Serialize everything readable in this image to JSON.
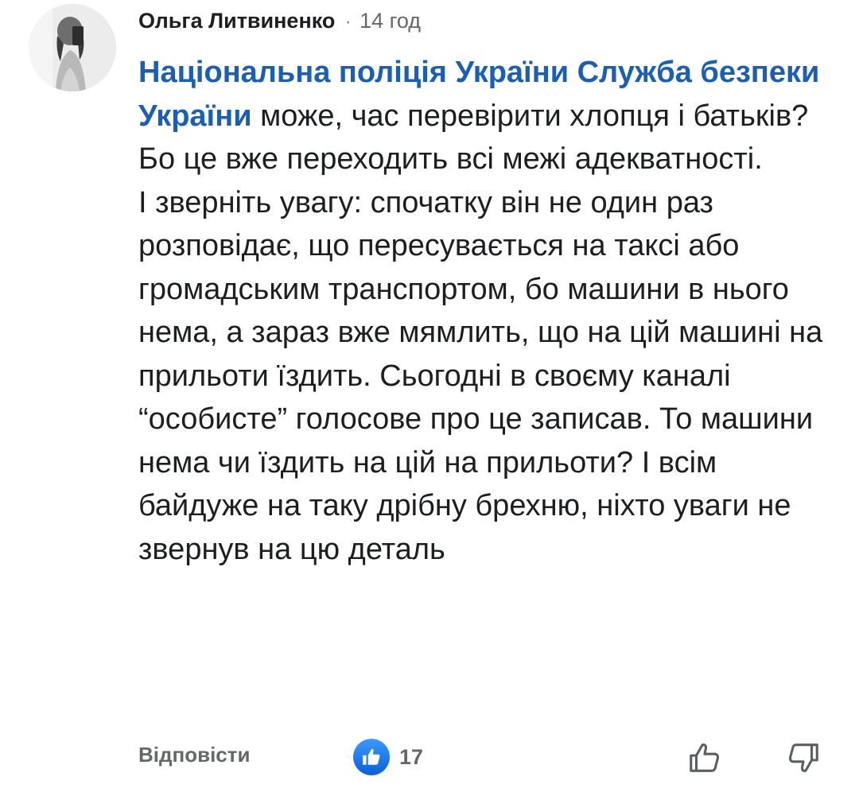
{
  "comment": {
    "author": "Ольга Литвиненко",
    "separator": "·",
    "time": "14 год",
    "mention": "Національна поліція України Служба безпеки України",
    "text_after_mention": " може, час перевірити хлопця і батьків? Бо це вже переходить всі межі адекватності.",
    "paragraph_2": "І зверніть увагу: спочатку він не один раз розповідає, що пересувається на таксі або громадським транспортом, бо машини в нього нема, а зараз вже мямлить, що на цій машині на прильоти їздить. Сьогодні в своєму каналі “особисте” голосове про це записав. То машини нема чи їздить на цій на прильоти? І всім байдуже на таку дрібну брехню, ніхто уваги не звернув на цю деталь"
  },
  "actions": {
    "reply_label": "Відповісти",
    "reaction_count": "17",
    "reaction_icon": "like-icon",
    "upvote_icon": "thumbs-up-icon",
    "downvote_icon": "thumbs-down-icon"
  },
  "colors": {
    "mention": "#1a5fb4",
    "like_badge": "#1877f2",
    "meta_text": "#65676b"
  }
}
